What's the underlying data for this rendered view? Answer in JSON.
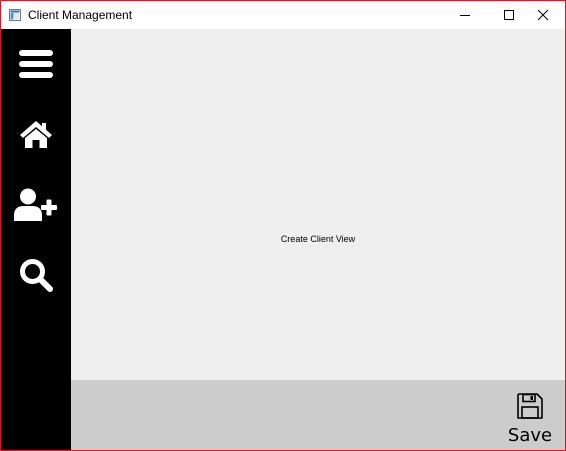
{
  "window": {
    "title": "Client Management",
    "border_color": "#e81123"
  },
  "sidebar": {
    "items": [
      {
        "icon": "menu-icon"
      },
      {
        "icon": "home-icon"
      },
      {
        "icon": "add-user-icon"
      },
      {
        "icon": "search-icon"
      }
    ],
    "background": "#000000"
  },
  "main": {
    "view_label": "Create Client View",
    "background": "#efefef"
  },
  "bottombar": {
    "save_label": "Save",
    "background": "#cccccc"
  }
}
